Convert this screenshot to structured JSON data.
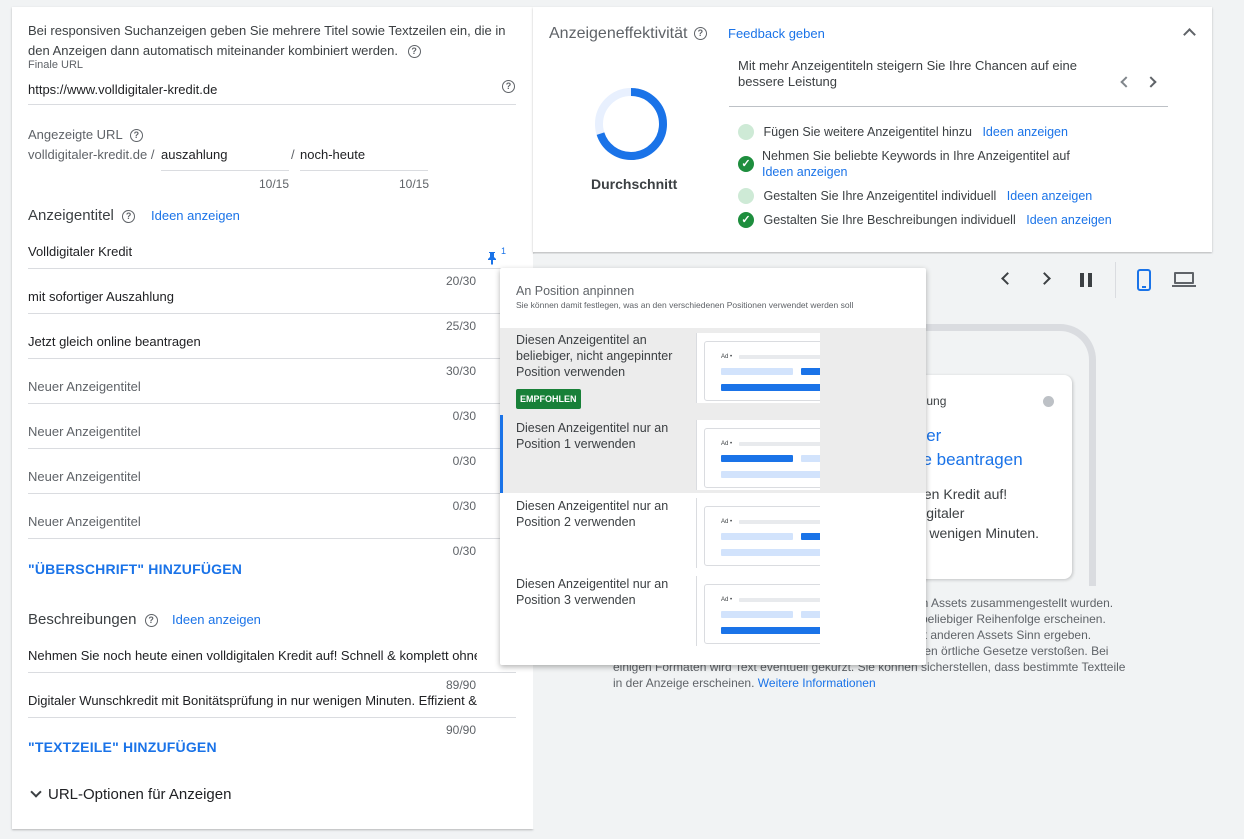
{
  "left": {
    "intro": "Bei responsiven Suchanzeigen geben Sie mehrere Titel sowie Textzeilen ein, die in den Anzeigen dann automatisch miteinander kombiniert werden.",
    "final_url_label": "Finale URL",
    "final_url_value": "https://www.volldigitaler-kredit.de",
    "display_url_label": "Angezeigte URL",
    "display_url_domain": "volldigitaler-kredit.de /",
    "path1": "auszahlung",
    "path1_counter": "10/15",
    "path_sep": "/",
    "path2": "noch-heute",
    "path2_counter": "10/15",
    "headlines_label": "Anzeigentitel",
    "headlines_ideas": "Ideen anzeigen",
    "pin_count": "1",
    "headlines": [
      {
        "text": "Volldigitaler Kredit",
        "counter": "20/30"
      },
      {
        "text": "mit sofortiger Auszahlung",
        "counter": "25/30"
      },
      {
        "text": "Jetzt gleich online beantragen",
        "counter": "30/30"
      }
    ],
    "new_headlines": [
      {
        "placeholder": "Neuer Anzeigentitel",
        "counter": "0/30"
      },
      {
        "placeholder": "Neuer Anzeigentitel",
        "counter": "0/30"
      },
      {
        "placeholder": "Neuer Anzeigentitel",
        "counter": "0/30"
      },
      {
        "placeholder": "Neuer Anzeigentitel",
        "counter": "0/30"
      }
    ],
    "add_headline": "\"ÜBERSCHRIFT\" HINZUFÜGEN",
    "descriptions_label": "Beschreibungen",
    "descriptions_ideas": "Ideen anzeigen",
    "descriptions": [
      {
        "text": "Nehmen Sie noch heute einen volldigitalen Kredit auf! Schnell & komplett ohne",
        "counter": "89/90"
      },
      {
        "text": "Digitaler Wunschkredit mit Bonitätsprüfung in nur wenigen Minuten. Effizient &",
        "counter": "90/90"
      }
    ],
    "add_description": "\"TEXTZEILE\" HINZUFÜGEN",
    "url_options": "URL-Optionen für Anzeigen"
  },
  "effectiveness": {
    "title": "Anzeigeneffektivität",
    "feedback": "Feedback geben",
    "rating": "Durchschnitt",
    "ring_fraction": 0.7,
    "tip": "Mit mehr Anzeigentiteln steigern Sie Ihre Chancen auf eine bessere Leistung",
    "items": [
      {
        "text": "Fügen Sie weitere Anzeigentitel hinzu",
        "link": "Ideen anzeigen",
        "done": false
      },
      {
        "text": "Nehmen Sie beliebte Keywords in Ihre Anzeigentitel auf",
        "link": "Ideen anzeigen",
        "done": true
      },
      {
        "text": "Gestalten Sie Ihre Anzeigentitel individuell",
        "link": "Ideen anzeigen",
        "done": false
      },
      {
        "text": "Gestalten Sie Ihre Beschreibungen individuell",
        "link": "Ideen anzeigen",
        "done": true
      }
    ]
  },
  "pin_popup": {
    "title": "An Position anpinnen",
    "subtitle": "Sie können damit festlegen, was an den verschiedenen Positionen verwendet werden soll",
    "options": [
      {
        "text": "Diesen Anzeigentitel an beliebiger, nicht angepinnter Position verwenden",
        "badge": "EMPFOHLEN"
      },
      {
        "text": "Diesen Anzeigentitel nur an Position 1 verwenden"
      },
      {
        "text": "Diesen Anzeigentitel nur an Position 2 verwenden"
      },
      {
        "text": "Diesen Anzeigentitel nur an Position 3 verwenden"
      }
    ],
    "thumb_ad_label": "Ad •"
  },
  "preview": {
    "card_url_fragment": "hlung",
    "card_title_1": "iger",
    "card_title_2": "ne beantragen",
    "card_desc_1": "alen Kredit auf!",
    "card_desc_2": "Digitaler",
    "card_desc_3": "ur wenigen Minuten.",
    "notice_lines": [
      "ren Assets zusammengestellt wurden.",
      "n beliebiger Reihenfolge erscheinen.",
      "mit anderen Assets Sinn ergeben.",
      "egen örtliche Gesetze verstoßen. Bei",
      "einigen Formaten wird Text eventuell gekürzt. Sie können sicherstellen, dass bestimmte Textteile",
      "in der Anzeige erscheinen."
    ],
    "more_info": "Weitere Informationen"
  },
  "colors": {
    "accent": "#1a73e8",
    "success": "#1e8e3e",
    "badge": "#188038"
  }
}
